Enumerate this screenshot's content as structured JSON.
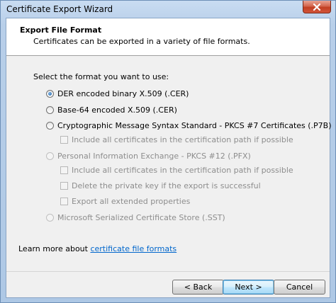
{
  "window": {
    "title": "Certificate Export Wizard"
  },
  "header": {
    "title": "Export File Format",
    "subtitle": "Certificates can be exported in a variety of file formats."
  },
  "prompt": "Select the format you want to use:",
  "options": [
    {
      "label": "DER encoded binary X.509 (.CER)",
      "checked": true,
      "enabled": true
    },
    {
      "label": "Base-64 encoded X.509 (.CER)",
      "checked": false,
      "enabled": true
    },
    {
      "label": "Cryptographic Message Syntax Standard - PKCS #7 Certificates (.P7B)",
      "checked": false,
      "enabled": true
    },
    {
      "label": "Personal Information Exchange - PKCS #12 (.PFX)",
      "checked": false,
      "enabled": false
    },
    {
      "label": "Microsoft Serialized Certificate Store (.SST)",
      "checked": false,
      "enabled": false
    }
  ],
  "p7b_options": [
    {
      "label": "Include all certificates in the certification path if possible",
      "checked": false,
      "enabled": false
    }
  ],
  "pfx_options": [
    {
      "label": "Include all certificates in the certification path if possible",
      "checked": false,
      "enabled": false
    },
    {
      "label": "Delete the private key if the export is successful",
      "checked": false,
      "enabled": false
    },
    {
      "label": "Export all extended properties",
      "checked": false,
      "enabled": false
    }
  ],
  "learn_more": {
    "prefix": "Learn more about ",
    "link": "certificate file formats"
  },
  "buttons": {
    "back": "< Back",
    "next": "Next >",
    "cancel": "Cancel"
  }
}
